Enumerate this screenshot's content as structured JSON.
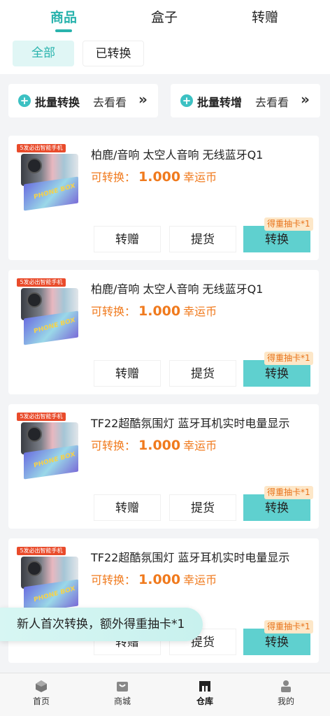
{
  "tabs": [
    {
      "label": "商品",
      "active": true
    },
    {
      "label": "盒子",
      "active": false
    },
    {
      "label": "转赠",
      "active": false
    }
  ],
  "filters": [
    {
      "label": "全部",
      "active": true
    },
    {
      "label": "已转换",
      "active": false
    }
  ],
  "promos": [
    {
      "title": "批量转换",
      "link": "去看看",
      "icon": "plus-circle-icon",
      "chevron": "»"
    },
    {
      "title": "批量转增",
      "link": "去看看",
      "icon": "plus-circle-icon",
      "chevron": "»"
    }
  ],
  "products": [
    {
      "tag": "5发必出智能手机",
      "box_label": "PHONE BOX",
      "title": "柏鹿/音响 太空人音响 无线蓝牙Q1",
      "price_label": "可转换：",
      "price": "1.000",
      "currency": "幸运币",
      "badge": "得重抽卡*1",
      "actions": [
        "转赠",
        "提货",
        "转换"
      ]
    },
    {
      "tag": "5发必出智能手机",
      "box_label": "PHONE BOX",
      "title": "柏鹿/音响 太空人音响 无线蓝牙Q1",
      "price_label": "可转换：",
      "price": "1.000",
      "currency": "幸运币",
      "badge": "得重抽卡*1",
      "actions": [
        "转赠",
        "提货",
        "转换"
      ]
    },
    {
      "tag": "5发必出智能手机",
      "box_label": "PHONE BOX",
      "title": "TF22超酷氛围灯 蓝牙耳机实时电量显示",
      "price_label": "可转换：",
      "price": "1.000",
      "currency": "幸运币",
      "badge": "得重抽卡*1",
      "actions": [
        "转赠",
        "提货",
        "转换"
      ]
    },
    {
      "tag": "5发必出智能手机",
      "box_label": "PHONE BOX",
      "title": "TF22超酷氛围灯 蓝牙耳机实时电量显示",
      "price_label": "可转换：",
      "price": "1.000",
      "currency": "幸运币",
      "badge": "得重抽卡*1",
      "actions": [
        "转赠",
        "提货",
        "转换"
      ]
    }
  ],
  "toast": "新人首次转换，额外得重抽卡*1",
  "nav": [
    {
      "label": "首页",
      "icon": "home-icon",
      "active": false
    },
    {
      "label": "商城",
      "icon": "shop-icon",
      "active": false
    },
    {
      "label": "仓库",
      "icon": "warehouse-icon",
      "active": true
    },
    {
      "label": "我的",
      "icon": "profile-icon",
      "active": false
    }
  ],
  "colors": {
    "accent": "#29b3ad",
    "price": "#f07a1d",
    "primary_button": "#5fd0cf",
    "badge_bg": "#fde7c8"
  }
}
